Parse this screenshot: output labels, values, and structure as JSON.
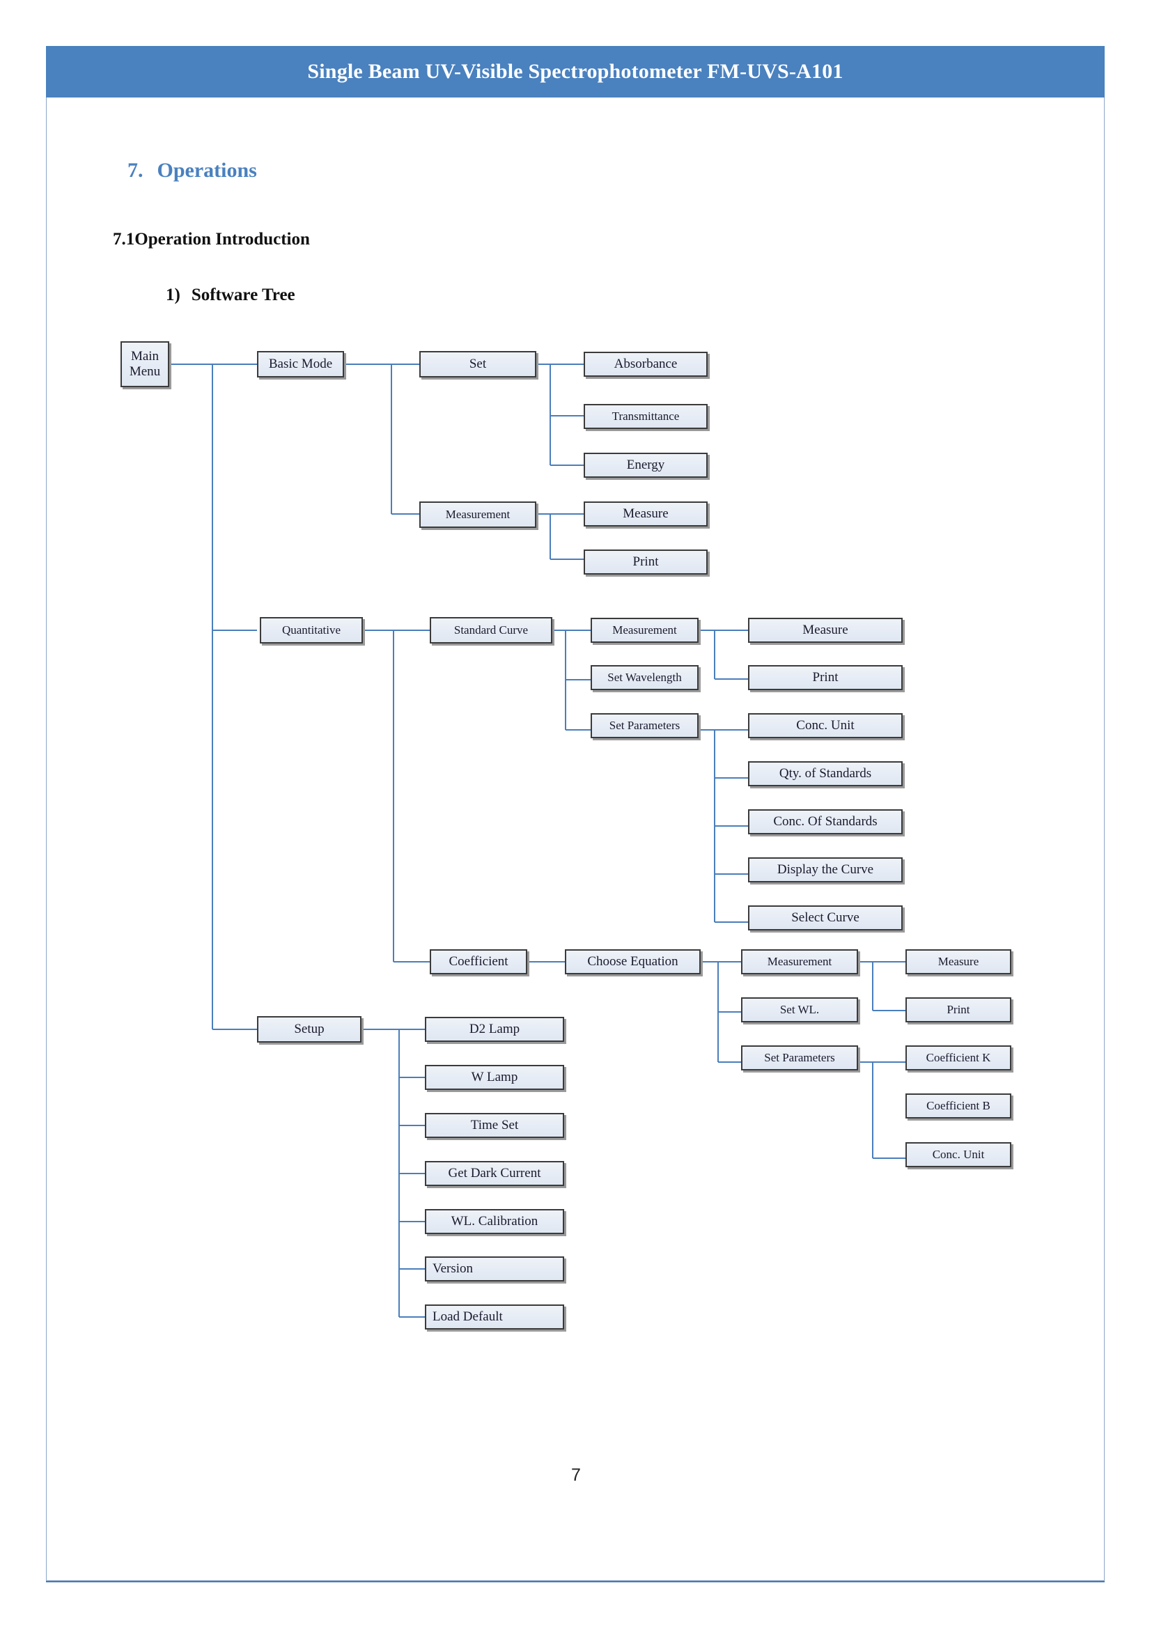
{
  "header": {
    "title": "Single Beam UV-Visible Spectrophotometer FM-UVS-A101"
  },
  "headings": {
    "section_number": "7.",
    "section_title": "Operations",
    "subsection": "7.1Operation Introduction",
    "item_number": "1)",
    "item_title": "Software Tree"
  },
  "footer": {
    "page_number": "7"
  },
  "colors": {
    "header_band": "#4a81bf",
    "heading_accent": "#4a81bf",
    "connector": "#4a7ebb",
    "node_fill": "#e6ecf5",
    "node_border": "#3b3b3b",
    "page_border": "#8ba7c9"
  },
  "tree": {
    "root": "Main\nMenu",
    "nodes": {
      "main_menu_line1": "Main",
      "main_menu_line2": "Menu",
      "basic_mode": "Basic Mode",
      "set": "Set",
      "absorbance": "Absorbance",
      "transmittance": "Transmittance",
      "energy": "Energy",
      "measurement_basic": "Measurement",
      "measure_basic": "Measure",
      "print_basic": "Print",
      "quantitative": "Quantitative",
      "standard_curve": "Standard Curve",
      "measurement_sc": "Measurement",
      "measure_sc": "Measure",
      "print_sc": "Print",
      "set_wavelength": "Set Wavelength",
      "set_parameters_sc": "Set Parameters",
      "conc_unit_sc": "Conc. Unit",
      "qty_of_standards": "Qty. of Standards",
      "conc_of_standards": "Conc. Of Standards",
      "display_the_curve": "Display  the Curve",
      "select_curve": "Select Curve",
      "coefficient": "Coefficient",
      "choose_equation": "Choose Equation",
      "measurement_coef": "Measurement",
      "measure_coef": "Measure",
      "print_coef": "Print",
      "set_wl": "Set WL.",
      "set_parameters_coef": "Set Parameters",
      "coefficient_k": "Coefficient K",
      "coefficient_b": "Coefficient B",
      "conc_unit_coef": "Conc. Unit",
      "setup": "Setup",
      "d2_lamp": "D2 Lamp",
      "w_lamp": "W Lamp",
      "time_set": "Time Set",
      "get_dark_current": "Get Dark Current",
      "wl_calibration": "WL. Calibration",
      "version": "Version",
      "load_default": "Load Default"
    },
    "structure": {
      "Main Menu": [
        "Basic Mode",
        "Quantitative",
        "Setup"
      ],
      "Basic Mode": [
        "Set",
        "Measurement"
      ],
      "Set": [
        "Absorbance",
        "Transmittance",
        "Energy"
      ],
      "Measurement": [
        "Measure",
        "Print"
      ],
      "Quantitative": [
        "Standard Curve",
        "Coefficient"
      ],
      "Standard Curve": [
        "Measurement",
        "Set Wavelength",
        "Set Parameters"
      ],
      "Set Parameters (Standard Curve)": [
        "Conc. Unit",
        "Qty. of Standards",
        "Conc. Of Standards",
        "Display  the Curve",
        "Select Curve"
      ],
      "Coefficient": [
        "Choose Equation"
      ],
      "Choose Equation": [
        "Measurement",
        "Set WL.",
        "Set Parameters"
      ],
      "Measurement (Coefficient)": [
        "Measure",
        "Print"
      ],
      "Set Parameters (Coefficient)": [
        "Coefficient K",
        "Coefficient B",
        "Conc. Unit"
      ],
      "Setup": [
        "D2 Lamp",
        "W Lamp",
        "Time Set",
        "Get Dark Current",
        "WL. Calibration",
        "Version",
        "Load Default"
      ]
    }
  }
}
